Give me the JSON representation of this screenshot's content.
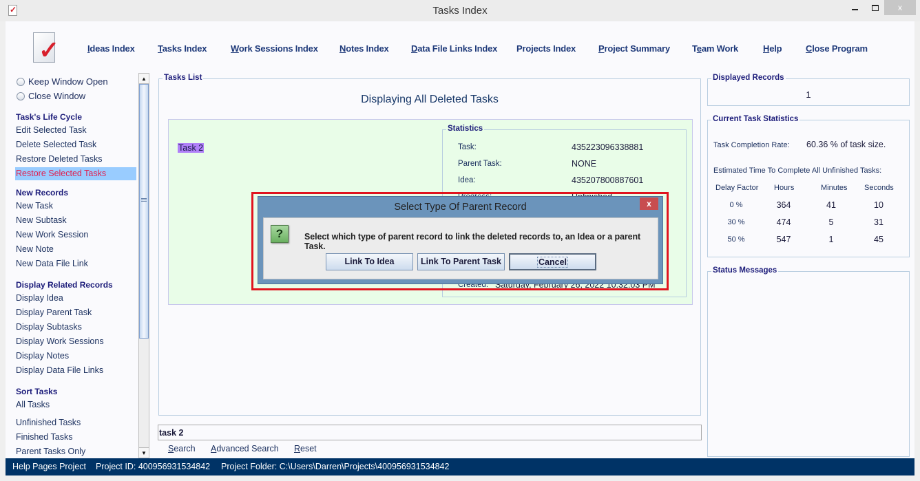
{
  "window": {
    "title": "Tasks Index",
    "controls": {
      "minimize": "minimize",
      "maximize": "maximize",
      "close": "x"
    }
  },
  "menu": [
    {
      "label": "Ideas Index",
      "mnemonic": "I"
    },
    {
      "label": "Tasks Index",
      "mnemonic": "T"
    },
    {
      "label": "Work Sessions Index",
      "mnemonic": "W"
    },
    {
      "label": "Notes Index",
      "mnemonic": "N"
    },
    {
      "label": "Data File Links Index",
      "mnemonic": "D"
    },
    {
      "label": "Projects Index",
      "mnemonic": ""
    },
    {
      "label": "Project Summary",
      "mnemonic": "P"
    },
    {
      "label": "Team Work",
      "mnemonic": "e"
    },
    {
      "label": "Help",
      "mnemonic": "H"
    },
    {
      "label": "Close Program",
      "mnemonic": "C"
    }
  ],
  "sidebar": {
    "radios": [
      {
        "label": "Keep Window Open",
        "checked": false
      },
      {
        "label": "Close Window",
        "checked": false
      }
    ],
    "sections": [
      {
        "heading": "Task's Life Cycle",
        "items": [
          "Edit Selected Task",
          "Delete Selected Task",
          "Restore Deleted Tasks",
          "Restore Selected Tasks"
        ],
        "selected": "Restore Selected Tasks"
      },
      {
        "heading": "New Records",
        "items": [
          "New Task",
          "New Subtask",
          "New Work Session",
          "New Note",
          "New Data File Link"
        ]
      },
      {
        "heading": "Display Related Records",
        "items": [
          "Display Idea",
          "Display Parent Task",
          "Display Subtasks",
          "Display Work Sessions",
          "Display Notes",
          "Display Data File Links"
        ]
      },
      {
        "heading": "Sort Tasks",
        "items": [
          "All Tasks",
          "Unfinished Tasks",
          "Finished Tasks",
          "Parent Tasks Only"
        ]
      }
    ]
  },
  "tasks_list": {
    "legend": "Tasks List",
    "heading": "Displaying All Deleted Tasks",
    "records": [
      {
        "name": "Task 2",
        "statistics": {
          "legend": "Statistics",
          "rows": [
            {
              "label": "Task:",
              "value": "435223096338881"
            },
            {
              "label": "Parent Task:",
              "value": "NONE"
            },
            {
              "label": "Idea:",
              "value": "435207800887601"
            },
            {
              "label": "Progress:",
              "value": "Unfinished"
            },
            {
              "label": "Created:",
              "value": "Saturday, February 26, 2022 10:32:03 PM"
            }
          ]
        }
      }
    ]
  },
  "search": {
    "value": "task 2",
    "links": [
      {
        "label": "Search",
        "mnemonic": "S"
      },
      {
        "label": "Advanced Search",
        "mnemonic": "A"
      },
      {
        "label": "Reset",
        "mnemonic": "R"
      }
    ]
  },
  "displayed_records": {
    "legend": "Displayed Records",
    "value": "1"
  },
  "current_task_statistics": {
    "legend": "Current Task Statistics",
    "completion_label": "Task Completion Rate:",
    "completion_value": "60.36 % of task size.",
    "estimate_label": "Estimated Time To Complete All Unfinished Tasks:",
    "columns": [
      "Delay Factor",
      "Hours",
      "Minutes",
      "Seconds"
    ],
    "rows": [
      [
        "0 %",
        "364",
        "41",
        "10"
      ],
      [
        "30 %",
        "474",
        "5",
        "31"
      ],
      [
        "50 %",
        "547",
        "1",
        "45"
      ]
    ]
  },
  "status_messages": {
    "legend": "Status Messages"
  },
  "statusbar": {
    "project": "Help Pages Project",
    "project_id": "Project ID:  400956931534842",
    "project_folder": "Project Folder: C:\\Users\\Darren\\Projects\\400956931534842"
  },
  "dialog": {
    "title": "Select Type Of Parent Record",
    "icon": "question-icon",
    "message": "Select which type of parent record to link the deleted records to, an Idea or a parent Task.",
    "buttons": [
      "Link To Idea",
      "Link To Parent Task",
      "Cancel"
    ],
    "focused_button": "Cancel",
    "close": "x",
    "highlight_color": "#e0141e"
  },
  "colors": {
    "accent": "#1f3a7a",
    "statusbar_bg": "#003366",
    "selected_item_bg": "#99ccff",
    "selected_item_text": "#e0204f",
    "record_bg": "#e9fde8",
    "task_highlight": "#b080f8",
    "dialog_frame": "#6b94bb"
  }
}
